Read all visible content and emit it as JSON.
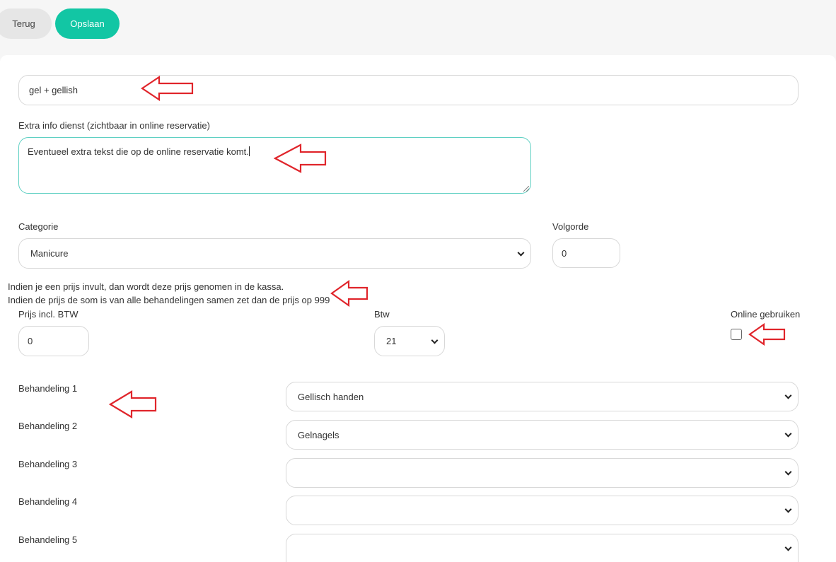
{
  "toolbar": {
    "back_label": "Terug",
    "save_label": "Opslaan"
  },
  "form": {
    "name_value": "gel + gellish",
    "extra_info_label": "Extra info dienst (zichtbaar in online reservatie)",
    "extra_info_value": "Eventueel extra tekst die op de online reservatie komt.",
    "category_label": "Categorie",
    "category_value": "Manicure",
    "order_label": "Volgorde",
    "order_value": "0",
    "price_note_line1": "Indien je een prijs invult, dan wordt deze prijs genomen in de kassa.",
    "price_note_line2": "Indien de prijs de som is van alle behandelingen samen zet dan de prijs op 999",
    "price_label": "Prijs incl. BTW",
    "price_value": "0",
    "vat_label": "Btw",
    "vat_value": "21",
    "online_label": "Online gebruiken",
    "online_checked": false,
    "treatments": [
      {
        "label": "Behandeling 1",
        "value": "Gellisch handen"
      },
      {
        "label": "Behandeling 2",
        "value": "Gelnagels"
      },
      {
        "label": "Behandeling 3",
        "value": ""
      },
      {
        "label": "Behandeling 4",
        "value": ""
      },
      {
        "label": "Behandeling 5",
        "value": ""
      }
    ]
  },
  "colors": {
    "accent": "#12c6a4",
    "annotation_arrow": "#e0252b",
    "focus_border": "#5fd0c3"
  },
  "icons": [
    "chevron-down-icon",
    "annotation-arrow-icon",
    "resize-grip-icon"
  ]
}
